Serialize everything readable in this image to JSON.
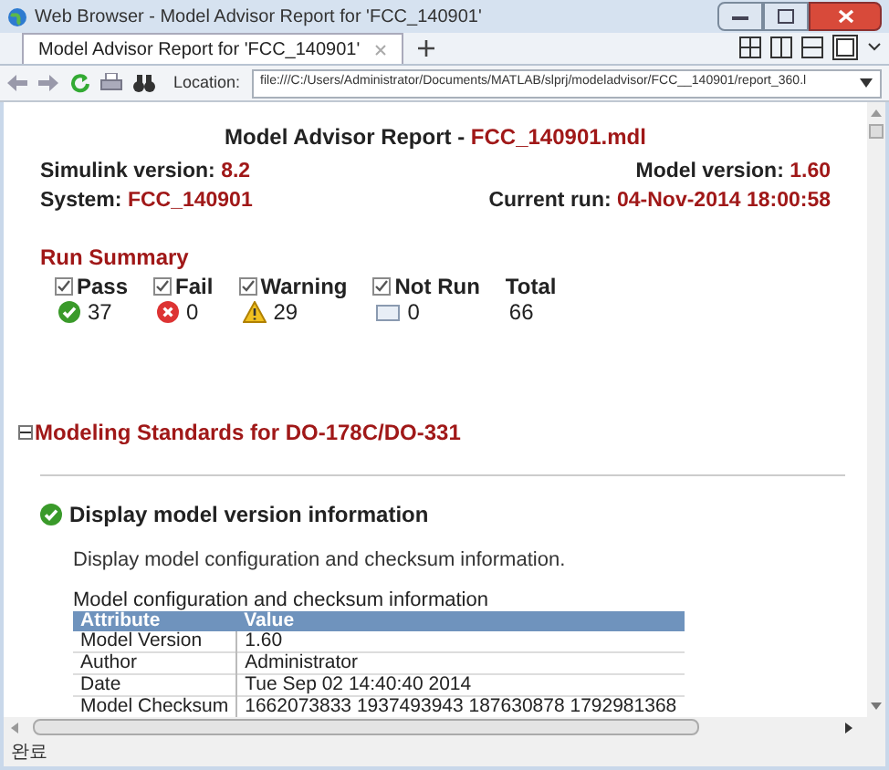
{
  "window": {
    "title": "Web Browser - Model Advisor Report for 'FCC_140901'"
  },
  "tabs": [
    {
      "label": "Model Advisor Report for 'FCC_140901'",
      "selected": true
    }
  ],
  "toolbar": {
    "location_label": "Location:",
    "url": "file:///C:/Users/Administrator/Documents/MATLAB/slprj/modeladvisor/FCC__140901/report_360.l"
  },
  "report": {
    "title": "Model Advisor Report - ",
    "file": "FCC_140901.mdl",
    "info": [
      {
        "label": "Simulink version: ",
        "value": "8.2"
      },
      {
        "label": "Model version: ",
        "value": "1.60"
      },
      {
        "label": "System: ",
        "value": "FCC_140901"
      },
      {
        "label": "Current run: ",
        "value": "04-Nov-2014 18:00:58"
      }
    ],
    "run_summary": {
      "title": "Run Summary",
      "items": [
        {
          "kind": "pass",
          "label": "Pass",
          "checked": true,
          "count": "37"
        },
        {
          "kind": "fail",
          "label": "Fail",
          "checked": true,
          "count": "0"
        },
        {
          "kind": "warning",
          "label": "Warning",
          "checked": true,
          "count": "29"
        },
        {
          "kind": "notrun",
          "label": "Not Run",
          "checked": true,
          "count": "0"
        },
        {
          "kind": "total",
          "label": "Total",
          "count": "66"
        }
      ]
    },
    "section": {
      "title": "Modeling Standards for DO-178C/DO-331",
      "expanded": true
    },
    "check": {
      "title": "Display model version information",
      "description": "Display model configuration and checksum information.",
      "table": {
        "caption": "Model configuration and checksum information",
        "columns": [
          "Attribute",
          "Value"
        ],
        "rows": [
          [
            "Model Version",
            "1.60"
          ],
          [
            "Author",
            "Administrator"
          ],
          [
            "Date",
            "Tue Sep 02 14:40:40 2014"
          ],
          [
            "Model Checksum",
            "1662073833 1937493943 187630878 1792981368"
          ]
        ]
      }
    }
  },
  "status_bar": {
    "text": "완료"
  }
}
